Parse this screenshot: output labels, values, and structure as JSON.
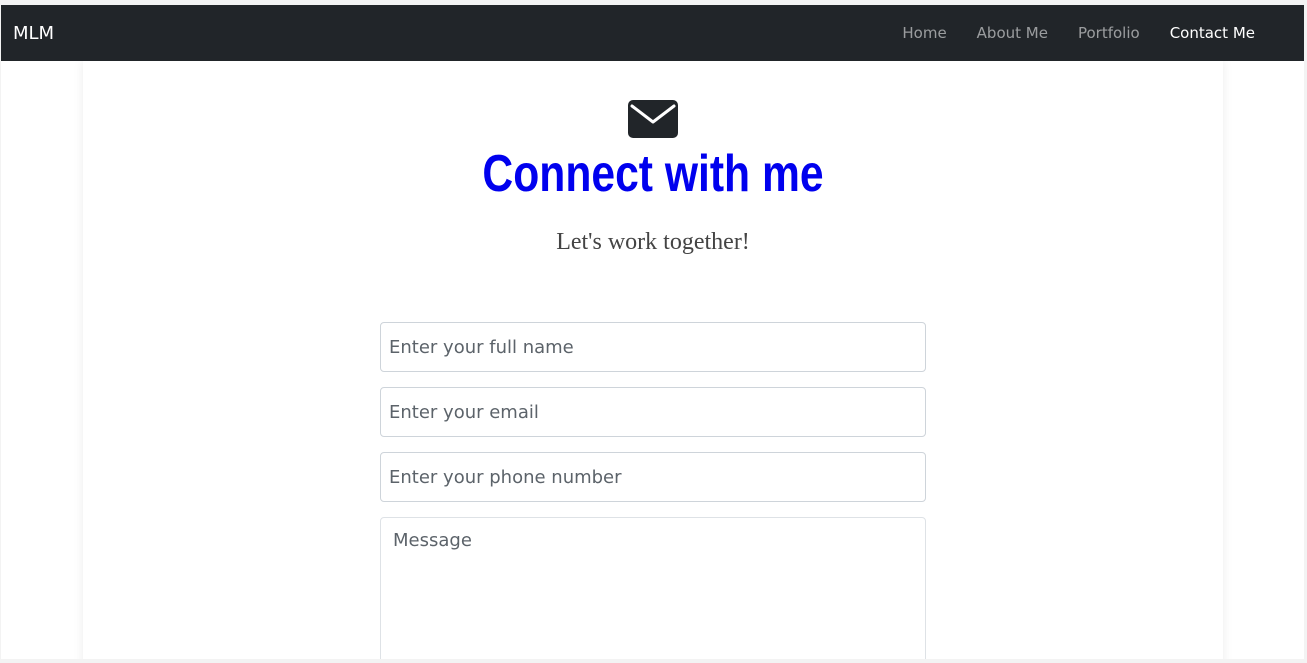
{
  "navbar": {
    "brand": "MLM",
    "links": [
      {
        "label": "Home",
        "active": false
      },
      {
        "label": "About Me",
        "active": false
      },
      {
        "label": "Portfolio",
        "active": false
      },
      {
        "label": "Contact Me",
        "active": true
      }
    ]
  },
  "contact": {
    "icon": "envelope-icon",
    "title": "Connect with me",
    "subtitle": "Let's work together!",
    "fields": {
      "name_placeholder": "Enter your full name",
      "email_placeholder": "Enter your email",
      "phone_placeholder": "Enter your phone number",
      "message_placeholder": "Message"
    }
  },
  "colors": {
    "navbar_bg": "#212529",
    "title_color": "#0000ee",
    "nav_active": "#ffffff",
    "nav_inactive": "rgba(255,255,255,0.55)"
  }
}
